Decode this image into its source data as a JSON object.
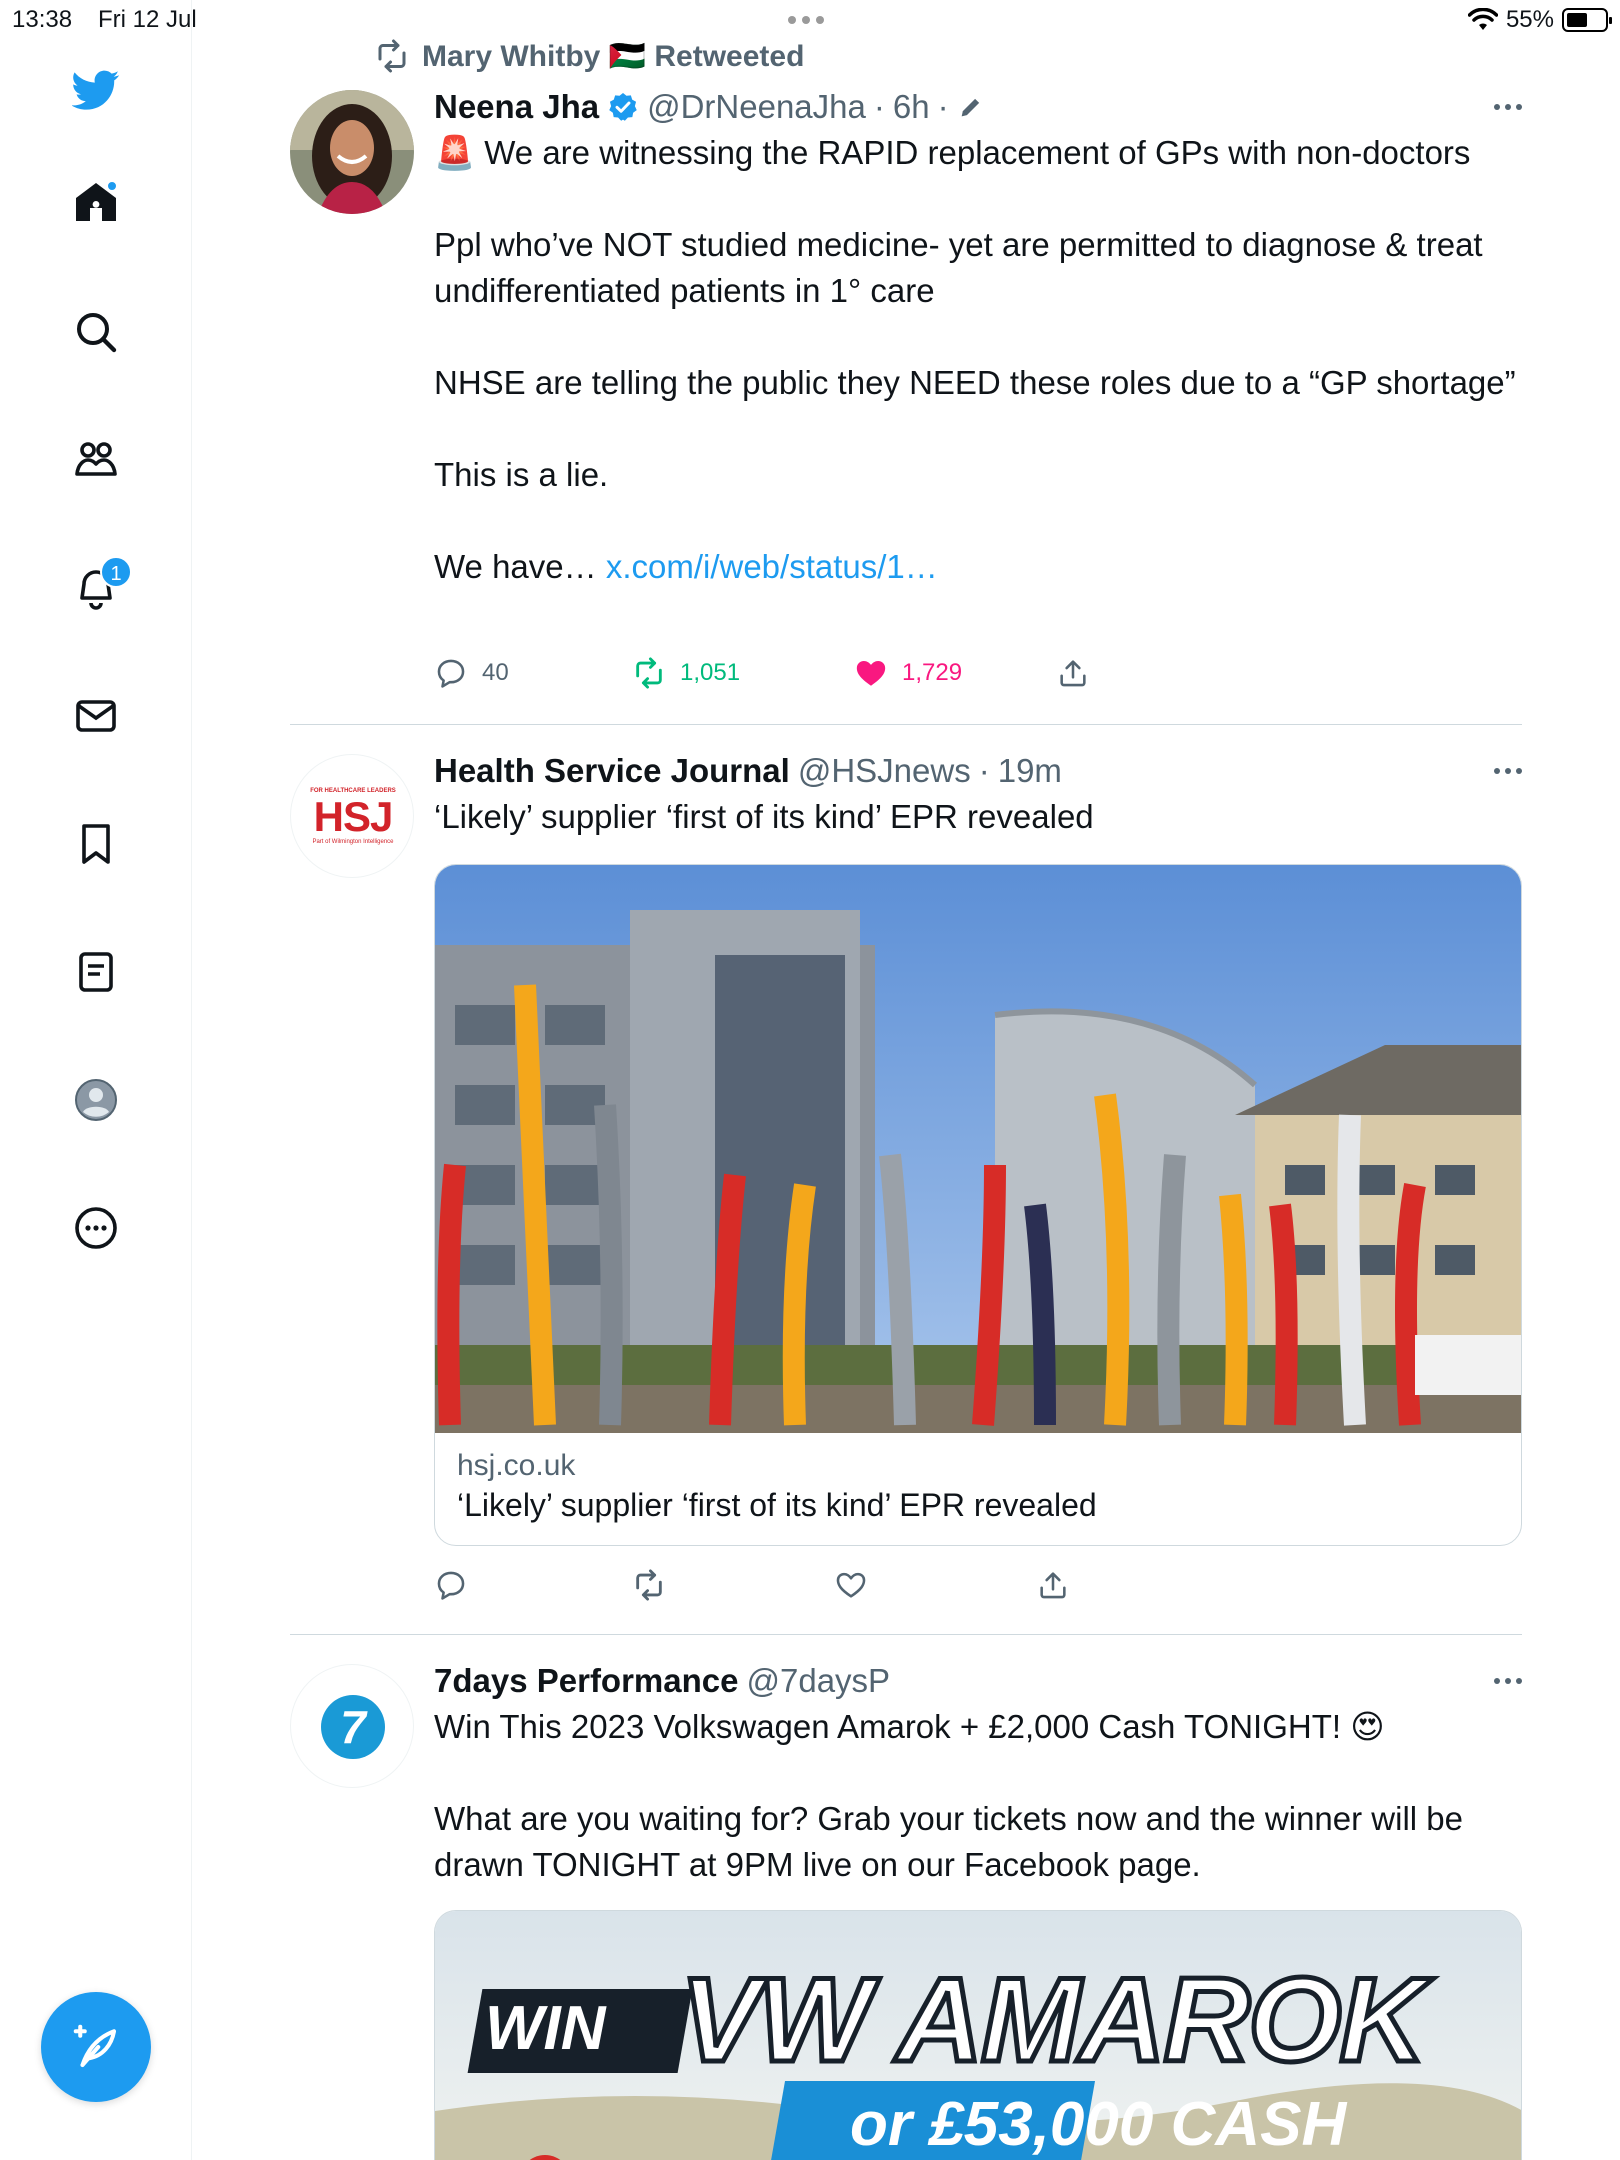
{
  "status_bar": {
    "time": "13:38",
    "date": "Fri 12 Jul",
    "battery": "55%"
  },
  "sidebar": {
    "notifications_count": "1"
  },
  "tweets": [
    {
      "retweet_context": "Mary Whitby 🇵🇸 Retweeted",
      "name": "Neena Jha",
      "handle": "@DrNeenaJha",
      "time": "6h",
      "paragraphs": [
        "🚨 We are witnessing the RAPID replacement of GPs with non-doctors",
        "Ppl who’ve NOT studied medicine- yet are permitted to diagnose & treat undifferentiated patients in 1° care",
        "NHSE are telling the public they NEED these roles due to a “GP shortage”",
        "This is a lie."
      ],
      "truncated_text": "We have… ",
      "link": "x.com/i/web/status/1…",
      "replies": "40",
      "retweets": "1,051",
      "likes": "1,729"
    },
    {
      "name": "Health Service Journal",
      "handle": "@HSJnews",
      "time": "19m",
      "text": "‘Likely’ supplier ‘first of its kind’ EPR revealed",
      "avatar_logo": "HSJ",
      "avatar_top": "FOR HEALTHCARE LEADERS",
      "avatar_bottom": "Part of Wilmington Intelligence",
      "card_domain": "hsj.co.uk",
      "card_title": "‘Likely’ supplier ‘first of its kind’ EPR revealed"
    },
    {
      "name": "7days Performance",
      "handle": "@7daysP",
      "time": "",
      "avatar_logo": "7",
      "paragraphs": [
        "Win This 2023 Volkswagen Amarok + £2,000 Cash TONIGHT! 😍",
        "What are you waiting for? Grab your tickets now and the winner will be drawn TONIGHT at 9PM live on our Facebook page."
      ],
      "promo_win": "WIN",
      "promo_headline": "VW AMAROK",
      "promo_sub": "or £53,000 CASH"
    }
  ],
  "colors": {
    "accent": "#1d9bf0",
    "retweet": "#00ba7c",
    "like": "#f91880",
    "hsj_red": "#d2232a"
  }
}
